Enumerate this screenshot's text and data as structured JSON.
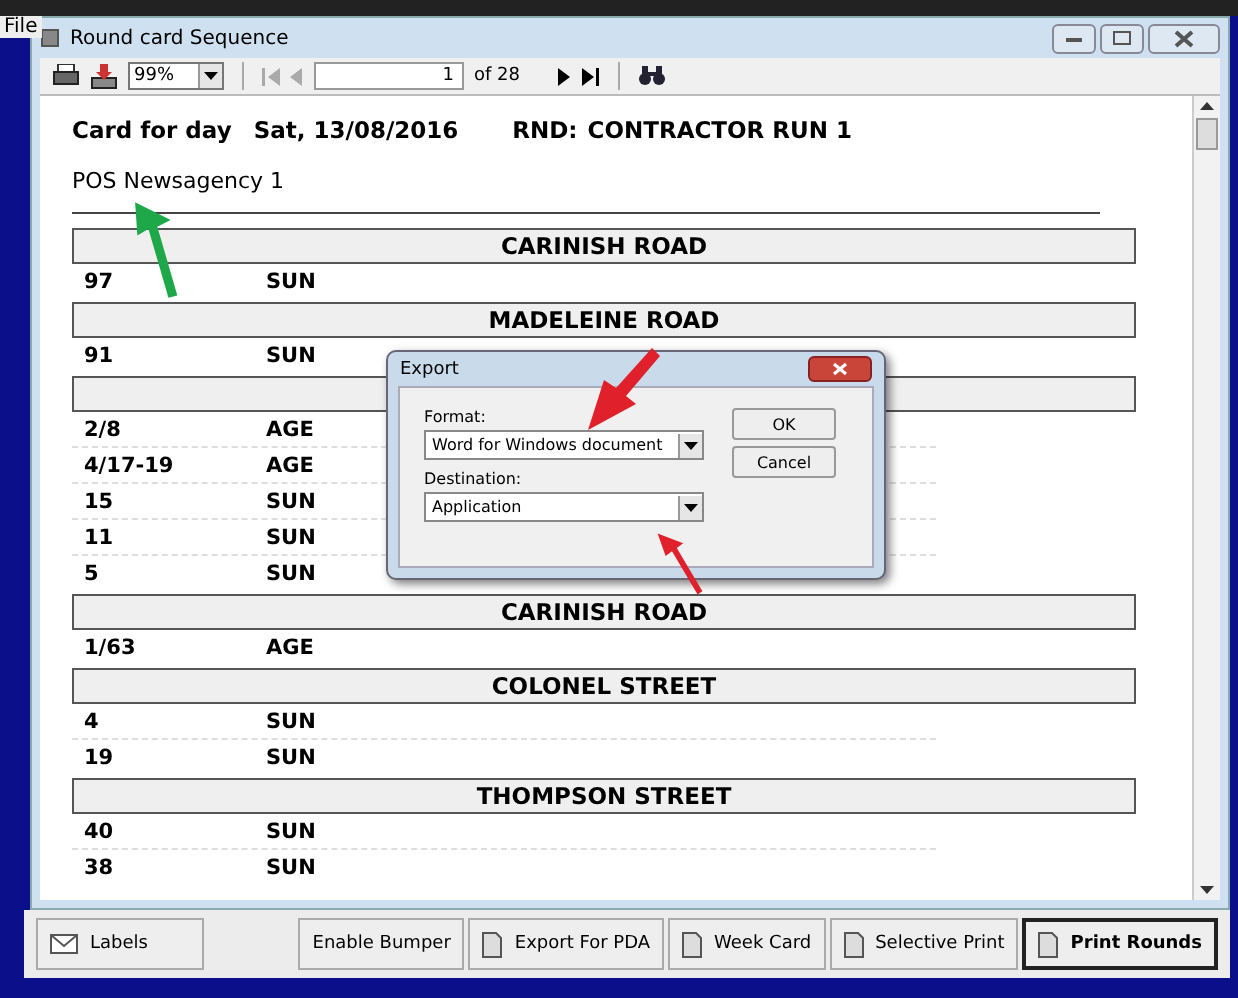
{
  "app_menu": {
    "label": "File"
  },
  "window": {
    "title": "Round card Sequence"
  },
  "toolbar": {
    "zoom": "99%",
    "page": "1",
    "page_count": "of 28"
  },
  "report": {
    "heading": {
      "label": "Card for day",
      "date": "Sat, 13/08/2016",
      "run_label": "RND:",
      "run": "CONTRACTOR RUN 1"
    },
    "subtitle": "POS Newsagency 1",
    "sections": [
      {
        "title": "CARINISH ROAD",
        "rows": [
          {
            "address": "97",
            "code": "SUN"
          }
        ]
      },
      {
        "title": "MADELEINE ROAD",
        "rows": [
          {
            "address": "91",
            "code": "SUN"
          }
        ]
      },
      {
        "rows": [
          {
            "address": "2/8",
            "code": "AGE"
          },
          {
            "address": "4/17-19",
            "code": "AGE"
          },
          {
            "address": "15",
            "code": "SUN"
          },
          {
            "address": "11",
            "code": "SUN"
          },
          {
            "address": "5",
            "code": "SUN"
          }
        ]
      },
      {
        "title": "CARINISH ROAD",
        "rows": [
          {
            "address": "1/63",
            "code": "AGE"
          }
        ]
      },
      {
        "title": "COLONEL STREET",
        "rows": [
          {
            "address": "4",
            "code": "SUN"
          },
          {
            "address": "19",
            "code": "SUN"
          }
        ]
      },
      {
        "title": "THOMPSON STREET",
        "rows": [
          {
            "address": "40",
            "code": "SUN"
          },
          {
            "address": "38",
            "code": "SUN"
          }
        ]
      }
    ]
  },
  "dialog": {
    "title": "Export",
    "format_label": "Format:",
    "format": "Word for Windows document",
    "destination_label": "Destination:",
    "destination": "Application",
    "buttons": [
      "OK",
      "Cancel"
    ]
  },
  "bottom_buttons": [
    {
      "label": "Labels",
      "kind": "envelope",
      "default": false
    },
    {
      "label": "Enable Bumper",
      "kind": "plain",
      "default": false
    },
    {
      "label": "Export For PDA",
      "kind": "page",
      "default": false
    },
    {
      "label": "Week Card",
      "kind": "page",
      "default": false
    },
    {
      "label": "Selective Print",
      "kind": "page",
      "default": false
    },
    {
      "label": "Print Rounds",
      "kind": "page",
      "default": true
    }
  ]
}
